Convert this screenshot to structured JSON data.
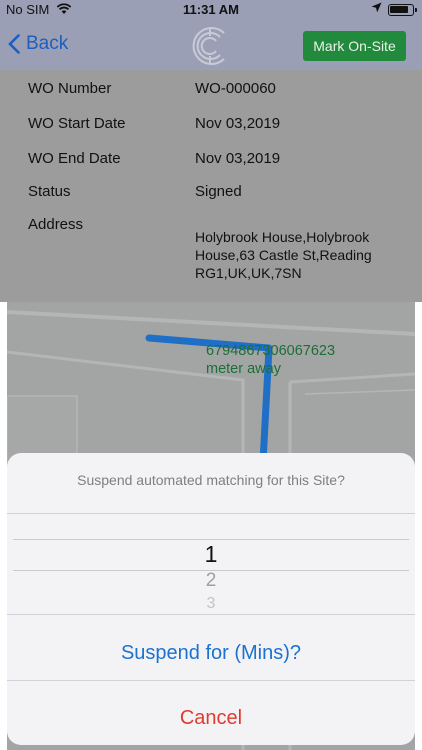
{
  "status_bar": {
    "carrier": "No SIM",
    "time": "11:31 AM"
  },
  "nav": {
    "back_label": "Back",
    "action_label": "Mark On-Site"
  },
  "details": [
    {
      "key": "WO Number",
      "value": "WO-000060"
    },
    {
      "key": "WO Start Date",
      "value": "Nov 03,2019"
    },
    {
      "key": "WO End Date",
      "value": "Nov 03,2019"
    },
    {
      "key": "Status",
      "value": "Signed"
    },
    {
      "key": "Address",
      "value": "Holybrook House,Holybrook House,63 Castle St,Reading RG1,UK,UK,7SN"
    }
  ],
  "map": {
    "distance_value": "6794867306067623",
    "distance_unit": "meter away"
  },
  "sheet": {
    "title": "Suspend automated matching for this Site?",
    "picker_options": [
      "1",
      "2",
      "3"
    ],
    "suspend_label": "Suspend for (Mins)?",
    "cancel_label": "Cancel"
  },
  "colors": {
    "nav_bg": "#9a9fb6",
    "accent_green": "#228a3c",
    "link_blue": "#1d72d0",
    "cancel_red": "#e03b2f",
    "route_blue": "#1f6fc7"
  },
  "icons": {
    "wifi": "wifi-icon",
    "location": "location-arrow-icon",
    "battery": "battery-icon",
    "back": "chevron-left-icon",
    "logo": "company-logo"
  }
}
